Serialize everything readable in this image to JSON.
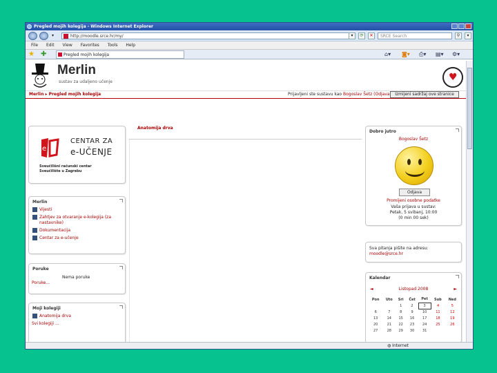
{
  "window": {
    "title": "Pregled mojih kolegija - Windows Internet Explorer"
  },
  "browser": {
    "address": "http://moodle.srce.hr/my/",
    "search_placeholder": "SRCE Search",
    "menu": [
      "File",
      "Edit",
      "View",
      "Favorites",
      "Tools",
      "Help"
    ],
    "tab_title": "Pregled mojih kolegija",
    "status": "Internet"
  },
  "site": {
    "name": "Merlin",
    "subtitle": "sustav za udaljeno učenje"
  },
  "navbar": {
    "breadcrumb": "Merlin ▸ Pregled mojih kolegija",
    "login_text": "Prijavljeni ste sustavu kao",
    "user": "Bogoslav Šetz",
    "logout": "(Odjava)",
    "edit_button": "Izmijeni sadržaj ove stranice"
  },
  "blocks": {
    "eu": {
      "line1": "CENTAR ZA",
      "line2": "e-UČENJE",
      "foot1": "Sveučilišni računski centar",
      "foot2": "Sveučilište u Zagrebu"
    },
    "merlin": {
      "title": "Merlin",
      "items": [
        "Vijesti",
        "Zahtjev za otvaranje e-kolegija (za nastavnike)",
        "Dokumentacija",
        "Centar za e-učenje"
      ]
    },
    "poruke": {
      "title": "Poruke",
      "empty": "Nema poruke",
      "link": "Poruke..."
    },
    "kolegiji": {
      "title": "Moji kolegiji",
      "items": [
        "Anatomija drva",
        "Svi kolegiji ..."
      ]
    },
    "welcome": {
      "title": "Dobro jutro",
      "name": "Bogoslav Šetz",
      "button": "Odjava",
      "profile": "Promijeni osobne podatke",
      "line1": "Vaša prijava u sustav:",
      "line2": "Petak, 5 svibanj, 10:00",
      "line3": "(0 min 00 sek)"
    },
    "contact": {
      "line1": "Sva pitanja pišite na adresu:",
      "line2": "moodle@srce.hr"
    },
    "calendar": {
      "title": "Kalendar",
      "month": "Listopad 2008",
      "prev": "◄",
      "next": "►",
      "days": [
        "Pon",
        "Uto",
        "Sri",
        "Čet",
        "Pet",
        "Sub",
        "Ned"
      ],
      "weeks": [
        [
          "",
          "",
          "1",
          "2",
          "3",
          "4",
          "5"
        ],
        [
          "6",
          "7",
          "8",
          "9",
          "10",
          "11",
          "12"
        ],
        [
          "13",
          "14",
          "15",
          "16",
          "17",
          "18",
          "19"
        ],
        [
          "20",
          "21",
          "22",
          "23",
          "24",
          "25",
          "26"
        ],
        [
          "27",
          "28",
          "29",
          "30",
          "31",
          "",
          ""
        ]
      ]
    }
  },
  "center": {
    "course_title": "Anatomija drva"
  }
}
